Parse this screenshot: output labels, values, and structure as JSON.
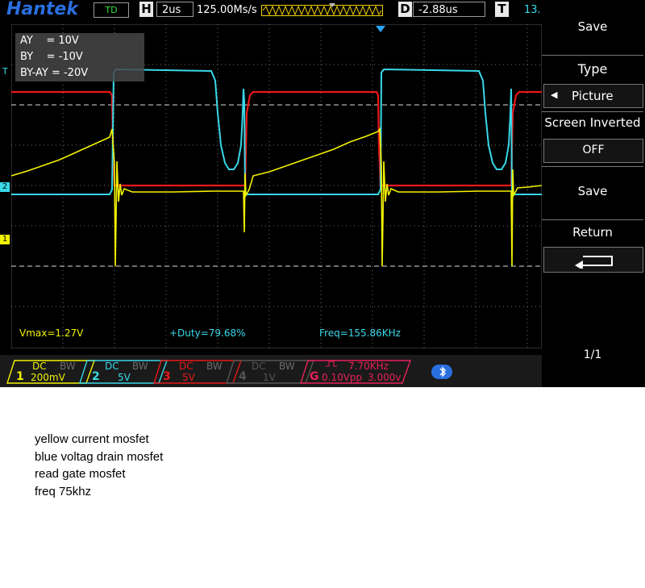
{
  "scope": {
    "brand": "Hantek",
    "trigger_mode": "TD",
    "horizontal": {
      "label": "H",
      "timebase": "2us",
      "sample_rate": "125.00Ms/s"
    },
    "delay": {
      "label": "D",
      "value": "-2.88us"
    },
    "trigger": {
      "label": "T",
      "value": "13."
    },
    "cursor_readout": {
      "ay": "AY    = 10V",
      "by": "BY    = -10V",
      "by_ay": "BY-AY = -20V"
    },
    "measurements": {
      "vmax": "Vmax=1.27V",
      "duty": "+Duty=79.68%",
      "freq": "Freq=155.86KHz"
    },
    "channels": [
      {
        "num": "1",
        "coupling": "DC",
        "bw": "BW",
        "scale": "200mV",
        "color": "#f2f200"
      },
      {
        "num": "2",
        "coupling": "DC",
        "bw": "BW",
        "scale": "5V",
        "color": "#38d8e8"
      },
      {
        "num": "3",
        "coupling": "DC",
        "bw": "BW",
        "scale": "5V",
        "color": "#e81818"
      },
      {
        "num": "4",
        "coupling": "DC",
        "bw": "BW",
        "scale": "1V",
        "color": "#555555"
      }
    ],
    "generator": {
      "label": "G",
      "freq": "7.70KHz",
      "amp": "0.10Vpp",
      "offset": "3.000v",
      "color": "#e8205a"
    },
    "markers": {
      "ch2": "2",
      "ch1": "1",
      "trig": "T"
    }
  },
  "menu": {
    "title": "Save",
    "type_label": "Type",
    "type_value": "Picture",
    "screen_inverted_label": "Screen Inverted",
    "screen_inverted_value": "OFF",
    "save_button": "Save",
    "return_label": "Return",
    "page": "1/1"
  },
  "notes": [
    "yellow current mosfet",
    "blue voltag drain mosfet",
    "read gate mosfet",
    "freq 75khz"
  ]
}
